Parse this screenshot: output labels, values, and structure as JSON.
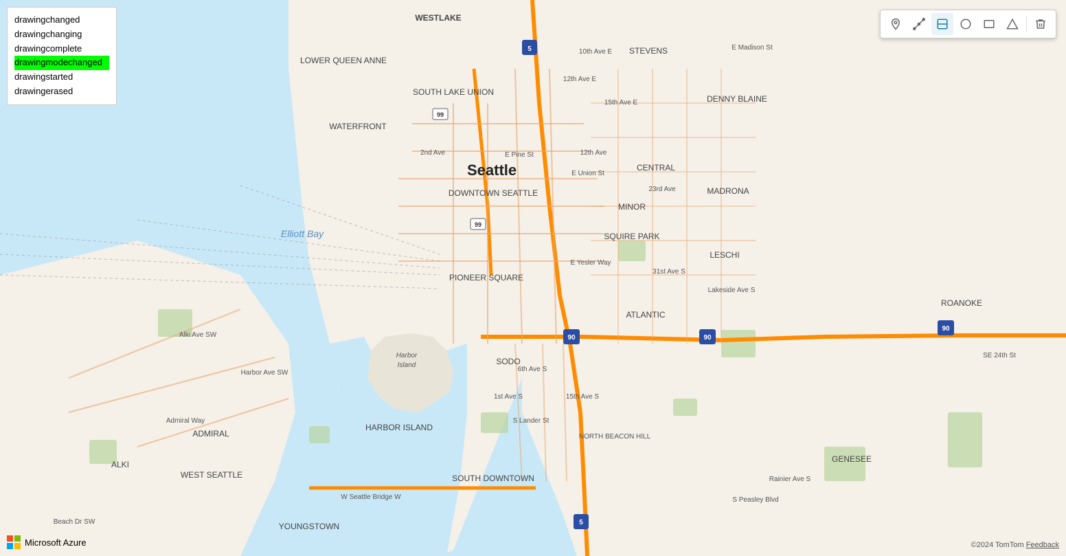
{
  "events": {
    "items": [
      {
        "id": "drawingchanged",
        "label": "drawingchanged",
        "highlighted": false
      },
      {
        "id": "drawingchanging",
        "label": "drawingchanging",
        "highlighted": false
      },
      {
        "id": "drawingcomplete",
        "label": "drawingcomplete",
        "highlighted": false
      },
      {
        "id": "drawingmodechanged",
        "label": "drawingmodechanged",
        "highlighted": true
      },
      {
        "id": "drawingstarted",
        "label": "drawingstarted",
        "highlighted": false
      },
      {
        "id": "drawingerased",
        "label": "drawingerased",
        "highlighted": false
      }
    ]
  },
  "toolbar": {
    "tools": [
      {
        "id": "point",
        "icon": "◇",
        "label": "Point tool",
        "active": false
      },
      {
        "id": "line",
        "icon": "⟋",
        "label": "Line tool",
        "active": false
      },
      {
        "id": "polygon",
        "icon": "✉",
        "label": "Polygon tool",
        "active": true
      },
      {
        "id": "circle",
        "icon": "○",
        "label": "Circle tool",
        "active": false
      },
      {
        "id": "rectangle",
        "icon": "□",
        "label": "Rectangle tool",
        "active": false
      },
      {
        "id": "triangle",
        "icon": "△",
        "label": "Triangle tool",
        "active": false
      },
      {
        "id": "erase",
        "icon": "🗑",
        "label": "Erase tool",
        "active": false
      }
    ]
  },
  "branding": {
    "name": "Microsoft Azure",
    "attribution": "©2024 TomTom",
    "feedback_label": "Feedback"
  },
  "map": {
    "center": "Seattle",
    "neighborhoods": [
      "WESTLAKE",
      "LOWER QUEEN ANNE",
      "SOUTH LAKE UNION",
      "WATERFRONT",
      "DOWNTOWN SEATTLE",
      "PIONEER SQUARE",
      "CENTRAL",
      "MADRONA",
      "MINOR",
      "SQUIRE PARK",
      "LESCHI",
      "ATLANTIC",
      "SODO",
      "NORTH BEACON HILL",
      "SOUTH DOWNTOWN",
      "ADMIRAL",
      "ALKI",
      "WEST SEATTLE",
      "HARBOR ISLAND",
      "YOUNGSTOWN",
      "GENESEE",
      "STEVENS",
      "DENNY BLAINE",
      "ROANOKE"
    ],
    "water": "Elliott Bay"
  }
}
